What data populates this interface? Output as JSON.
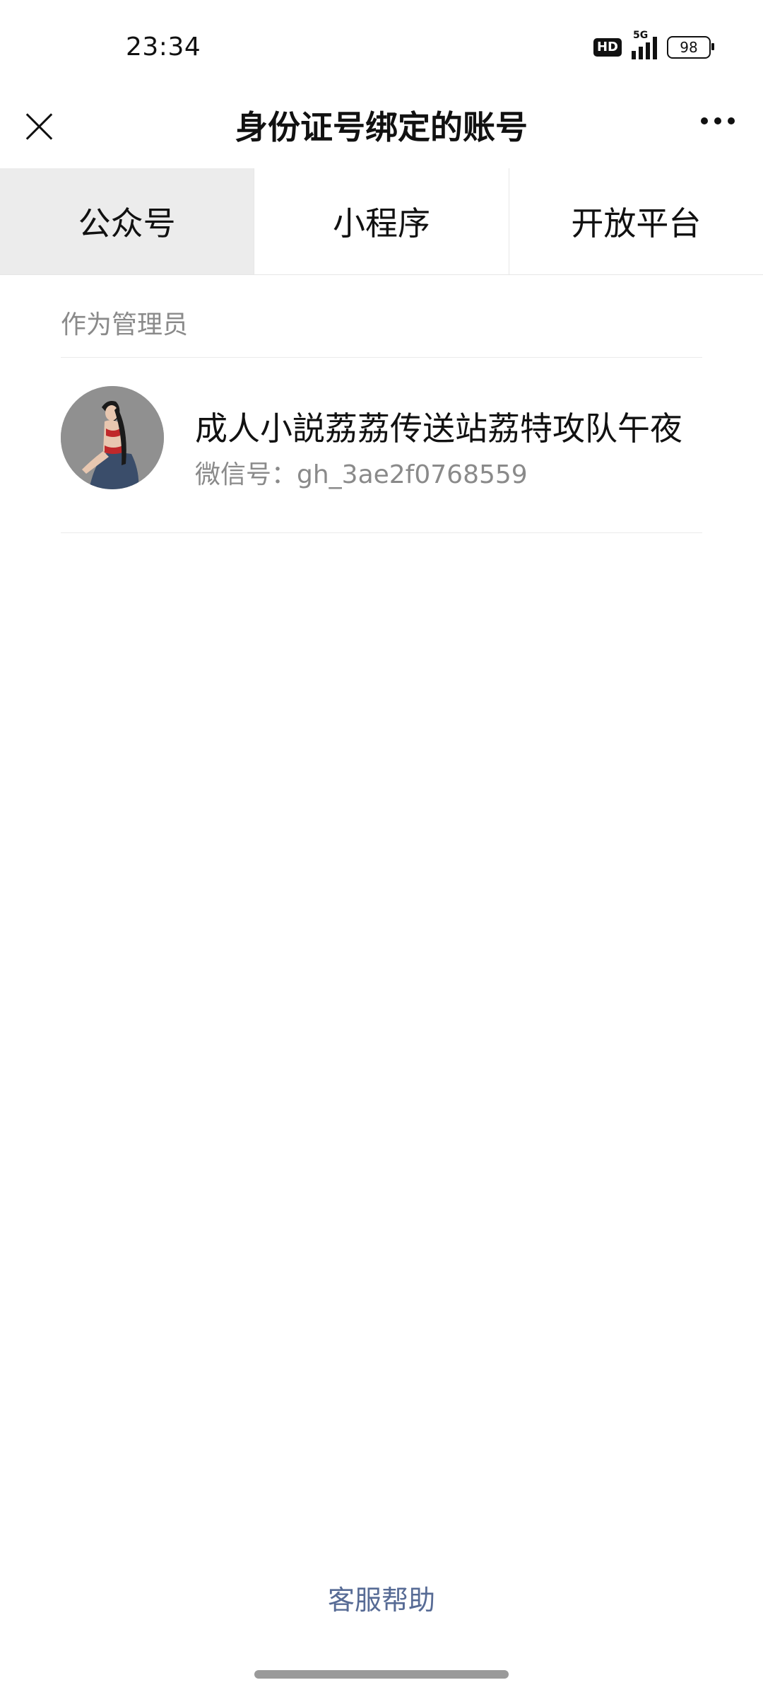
{
  "status_bar": {
    "time": "23:34",
    "hd_badge": "HD",
    "network": "5G",
    "battery": "98"
  },
  "nav": {
    "title": "身份证号绑定的账号",
    "close_icon": "close-icon",
    "more_icon": "more-icon"
  },
  "tabs": [
    {
      "label": "公众号",
      "active": true
    },
    {
      "label": "小程序",
      "active": false
    },
    {
      "label": "开放平台",
      "active": false
    }
  ],
  "section": {
    "label": "作为管理员"
  },
  "accounts": [
    {
      "name": "成人小説荔荔传送站荔特攻队午夜",
      "wechat_id": "微信号：gh_3ae2f0768559"
    }
  ],
  "footer": {
    "help_label": "客服帮助"
  }
}
